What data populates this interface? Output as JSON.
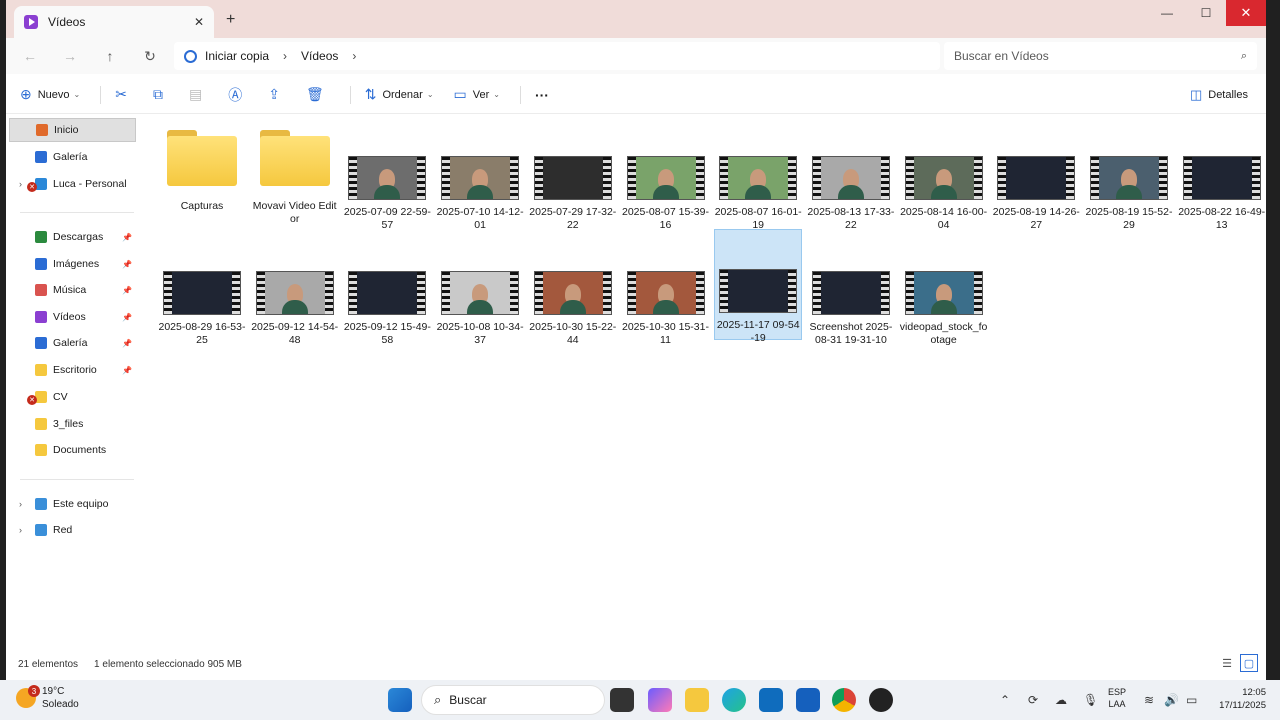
{
  "window": {
    "tab_title": "Vídeos",
    "tab_close": "✕",
    "new_tab": "+",
    "minimize": "—",
    "maximize": "☐",
    "close": "✕"
  },
  "address": {
    "back": "←",
    "forward": "→",
    "up": "↑",
    "refresh": "↻",
    "crumbs": [
      "Iniciar copia",
      "Vídeos"
    ],
    "separator": "›",
    "search_placeholder": "Buscar en Vídeos",
    "search_icon": "⌕"
  },
  "commands": {
    "new_label": "Nuevo",
    "sort_label": "Ordenar",
    "view_label": "Ver",
    "more": "···",
    "details_label": "Detalles"
  },
  "sidebar": {
    "items": [
      {
        "label": "Inicio",
        "icon": "home-icon",
        "color": "#e06a2b"
      },
      {
        "label": "Galería",
        "icon": "gallery-icon",
        "color": "#2b6cd4"
      },
      {
        "label": "Luca - Personal",
        "icon": "onedrive-icon",
        "color": "#2b88d8"
      },
      {
        "label": "Descargas",
        "icon": "download-icon",
        "color": "#2b8a3e"
      },
      {
        "label": "Imágenes",
        "icon": "pictures-icon",
        "color": "#2b6cd4"
      },
      {
        "label": "Música",
        "icon": "music-icon",
        "color": "#d9534f"
      },
      {
        "label": "Vídeos",
        "icon": "videos-icon",
        "color": "#8b3fd1"
      },
      {
        "label": "Galería",
        "icon": "gallery-icon",
        "color": "#2b6cd4"
      },
      {
        "label": "Escritorio",
        "icon": "desktop-icon",
        "color": "#f5c83e"
      },
      {
        "label": "CV",
        "icon": "folder-icon",
        "color": "#f5c83e"
      },
      {
        "label": "3_files",
        "icon": "folder-icon",
        "color": "#f5c83e"
      },
      {
        "label": "Documents",
        "icon": "folder-icon",
        "color": "#f5c83e"
      },
      {
        "label": "Este equipo",
        "icon": "computer-icon",
        "color": "#3a8fd9"
      },
      {
        "label": "Red",
        "icon": "network-icon",
        "color": "#3a8fd9"
      }
    ]
  },
  "files": [
    {
      "name": "Capturas",
      "type": "folder"
    },
    {
      "name": "Movavi Video Editor",
      "type": "folder"
    },
    {
      "name": "2025-07-09 22-59-57",
      "type": "video"
    },
    {
      "name": "2025-07-10 14-12-01",
      "type": "video"
    },
    {
      "name": "2025-07-29 17-32-22",
      "type": "video"
    },
    {
      "name": "2025-08-07 15-39-16",
      "type": "video"
    },
    {
      "name": "2025-08-07 16-01-19",
      "type": "video"
    },
    {
      "name": "2025-08-13 17-33-22",
      "type": "video"
    },
    {
      "name": "2025-08-14 16-00-04",
      "type": "video"
    },
    {
      "name": "2025-08-19 14-26-27",
      "type": "video"
    },
    {
      "name": "2025-08-19 15-52-29",
      "type": "video"
    },
    {
      "name": "2025-08-22 16-49-13",
      "type": "video"
    },
    {
      "name": "2025-08-29 16-53-25",
      "type": "video"
    },
    {
      "name": "2025-09-12 14-54-48",
      "type": "video"
    },
    {
      "name": "2025-09-12 15-49-58",
      "type": "video"
    },
    {
      "name": "2025-10-08 10-34-37",
      "type": "video"
    },
    {
      "name": "2025-10-30 15-22-44",
      "type": "video"
    },
    {
      "name": "2025-10-30 15-31-11",
      "type": "video"
    },
    {
      "name": "2025-11-17 09-54-19",
      "type": "video",
      "selected": true
    },
    {
      "name": "Screenshot 2025-08-31 19-31-10",
      "type": "video"
    },
    {
      "name": "videopad_stock_footage",
      "type": "video"
    }
  ],
  "status": {
    "count": "21 elementos",
    "selection": "1 elemento seleccionado  905 MB"
  },
  "taskbar": {
    "temperature": "19°C",
    "weather": "Soleado",
    "weather_badge": "3",
    "search_label": "Buscar",
    "lang_top": "ESP",
    "lang_bottom": "LAA",
    "time": "12:05",
    "date": "17/11/2025"
  }
}
